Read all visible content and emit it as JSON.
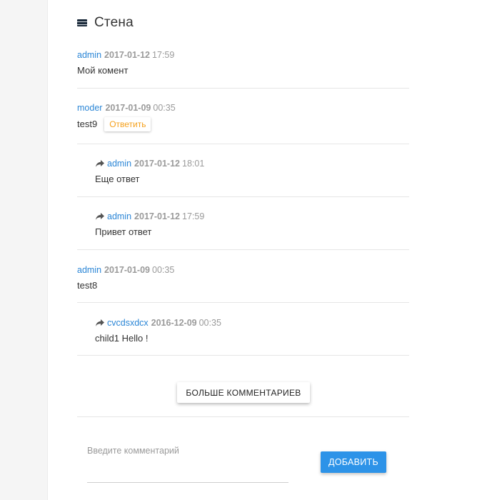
{
  "wall": {
    "title": "Стена"
  },
  "comments": [
    {
      "author": "admin",
      "date": "2017-01-12",
      "time": "17:59",
      "text": "Мой комент"
    },
    {
      "author": "moder",
      "date": "2017-01-09",
      "time": "00:35",
      "text": "test9",
      "reply_label": "Ответить"
    },
    {
      "author": "admin",
      "date": "2017-01-12",
      "time": "18:01",
      "text": "Еще ответ"
    },
    {
      "author": "admin",
      "date": "2017-01-12",
      "time": "17:59",
      "text": "Привет ответ"
    },
    {
      "author": "admin",
      "date": "2017-01-09",
      "time": "00:35",
      "text": "test8"
    },
    {
      "author": "cvcdsxdcx",
      "date": "2016-12-09",
      "time": "00:35",
      "text": "child1 Hello !"
    }
  ],
  "more_button": "БОЛЬШЕ КОММЕНТАРИЕВ",
  "comment_form": {
    "placeholder": "Введите комментарий",
    "value": "",
    "submit_label": "ДОБАВИТЬ"
  },
  "colors": {
    "link": "#2b86d6",
    "reply_accent": "#f5a11d",
    "primary_button": "#2d93e8"
  }
}
